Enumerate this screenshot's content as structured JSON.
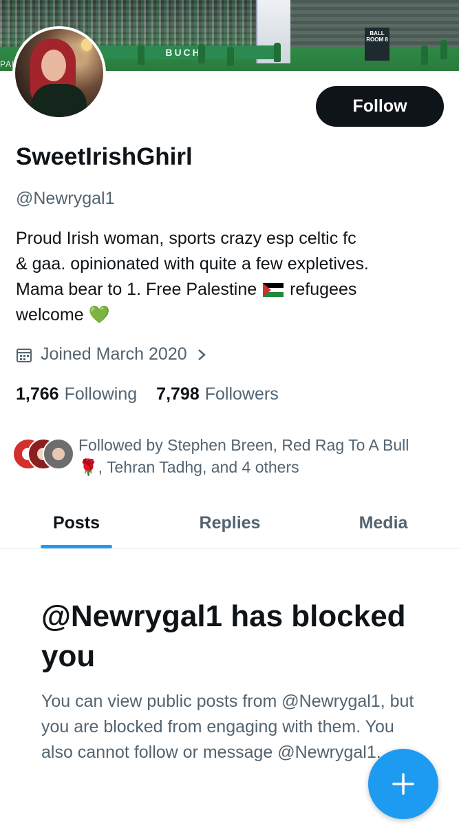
{
  "profile": {
    "banner_ad_text": "BUCHI",
    "banner_sign_text": "BALL ROOM 8",
    "banner_edge_text": "PAI",
    "display_name": "SweetIrishGhirl",
    "handle": "@Newrygal1",
    "bio_line1": "Proud Irish woman, sports crazy esp celtic fc",
    "bio_line2": "& gaa. opinionated with quite a few expletives.",
    "bio_line3_start": "Mama bear to 1.  Free Palestine",
    "bio_line3_end": " refugees",
    "bio_line4": "welcome",
    "heart_emoji": "💚",
    "joined": "Joined March 2020",
    "follow_button": "Follow"
  },
  "stats": {
    "following_count": "1,766",
    "following_label": "Following",
    "followers_count": "7,798",
    "followers_label": "Followers"
  },
  "followed_by": {
    "text_before": "Followed by Stephen Breen, Red Rag To A Bull",
    "rose_emoji": "🌹",
    "text_after": ", Tehran Tadhg, and 4 others"
  },
  "tabs": [
    {
      "label": "Posts",
      "active": true
    },
    {
      "label": "Replies",
      "active": false
    },
    {
      "label": "Media",
      "active": false
    }
  ],
  "blocked": {
    "title": "@Newrygal1 has blocked you",
    "body": "You can view public posts from @Newrygal1, but you are blocked from engaging with them. You also cannot follow or message @Newrygal1."
  },
  "colors": {
    "accent": "#1d9bf0",
    "text_primary": "#0f1419",
    "text_secondary": "#536471"
  },
  "icons": {
    "joined": "calendar-icon",
    "joined_more": "chevron-right-icon",
    "compose": "plus-icon"
  }
}
